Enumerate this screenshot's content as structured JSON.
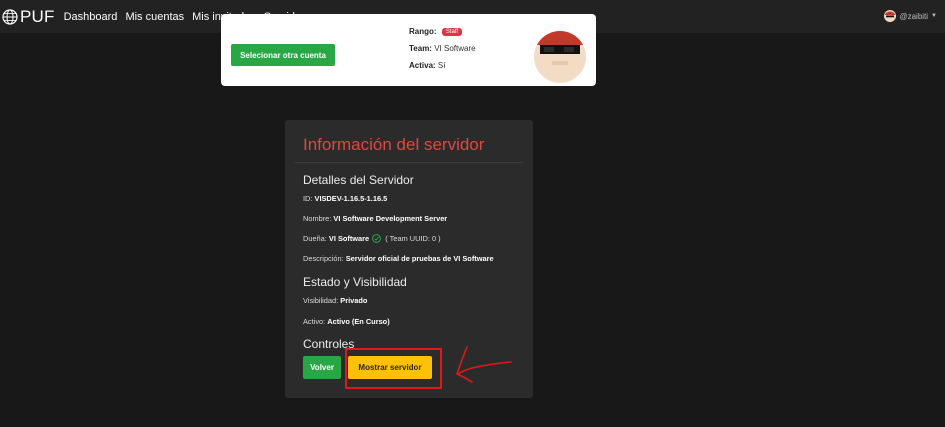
{
  "navbar": {
    "brand": "PUF",
    "links": [
      "Dashboard",
      "Mis cuentas",
      "Mis invitados",
      "Servidores"
    ],
    "user": "@zaibiti"
  },
  "account_card": {
    "select_button": "Selecionar otra cuenta",
    "rank_label": "Rango:",
    "rank_badge": "Staff",
    "team_label": "Team:",
    "team_value": "VI Software",
    "active_label": "Activa:",
    "active_value": "Sí"
  },
  "server_panel": {
    "title": "Información del servidor",
    "details_heading": "Detalles del Servidor",
    "id_label": "ID:",
    "id_value": "VISDEV-1.16.5-1.16.5",
    "name_label": "Nombre:",
    "name_value": "VI Software Development Server",
    "owner_label": "Dueña:",
    "owner_value": "VI Software",
    "owner_team": "( Team UUID: 0 )",
    "description_label": "Descripción:",
    "description_value": "Servidor oficial de pruebas de VI Software",
    "status_heading": "Estado y Visibilidad",
    "visibility_label": "Visibilidad:",
    "visibility_value": "Privado",
    "active_label": "Activo:",
    "active_value": "Activo (En Curso)",
    "controls_heading": "Controles",
    "back_button": "Volver",
    "show_button": "Mostrar servidor"
  },
  "colors": {
    "accent_red": "#e0483e",
    "success_green": "#28a745",
    "warning_yellow": "#ffc107",
    "annotation_red": "#e01818"
  }
}
